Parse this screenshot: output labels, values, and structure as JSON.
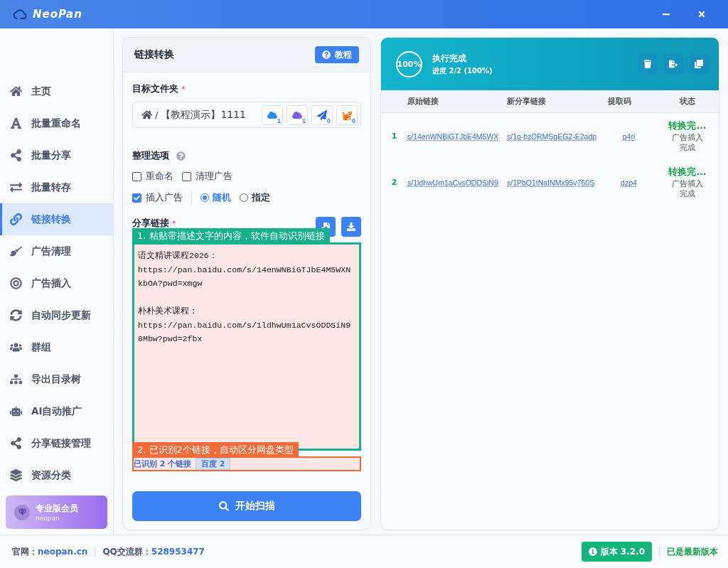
{
  "window": {
    "title": "NeoPan"
  },
  "sidebar": {
    "items": [
      {
        "label": "主页",
        "selected": false
      },
      {
        "label": "批量重命名",
        "selected": false
      },
      {
        "label": "批量分享",
        "selected": false
      },
      {
        "label": "批量转存",
        "selected": false
      },
      {
        "label": "链接转换",
        "selected": true
      },
      {
        "label": "广告清理",
        "selected": false
      },
      {
        "label": "广告插入",
        "selected": false
      },
      {
        "label": "自动同步更新",
        "selected": false
      },
      {
        "label": "群组",
        "selected": false
      },
      {
        "label": "导出目录树",
        "selected": false
      },
      {
        "label": "AI自动推广",
        "selected": false
      },
      {
        "label": "分享链接管理",
        "selected": false
      },
      {
        "label": "资源分类",
        "selected": false
      }
    ],
    "member": {
      "title": "专业版会员",
      "subtitle": "neopan"
    }
  },
  "convert_panel": {
    "title": "链接转换",
    "help_button": "教程",
    "target_folder": {
      "label": "目标文件夹",
      "required_mark": "*",
      "separator": "/",
      "path": "【教程演示】1111",
      "services": [
        {
          "count": "1"
        },
        {
          "count": "1"
        },
        {
          "count": "0"
        },
        {
          "count": "0"
        }
      ]
    },
    "options": {
      "label": "整理选项",
      "checkboxes": [
        {
          "label": "重命名",
          "checked": false
        },
        {
          "label": "清理广告",
          "checked": false
        },
        {
          "label": "插入广告",
          "checked": true
        }
      ],
      "radios": [
        {
          "label": "随机",
          "selected": true
        },
        {
          "label": "指定",
          "selected": false
        }
      ]
    },
    "share_links": {
      "label": "分享链接",
      "required_mark": "*",
      "value": "语文精讲课程2026：\nhttps://pan.baidu.com/s/14enWNBiGTJbE4M5WXNkbOA?pwd=xmgw\n\n朴朴美术课程：\nhttps://pan.baidu.com/s/1ldhwUm1aCvsODDSiN98Mbw?pwd=2fbx",
      "detected": "已识别 2 个链接",
      "tags": [
        "百度 2"
      ]
    },
    "start_button": "开始扫描",
    "annotations": [
      {
        "text": "1. 粘贴带描述文字的内容，软件自动识别链接",
        "color": "#16b08b"
      },
      {
        "text": "2. 已识别2个链接，自动区分网盘类型",
        "color": "#f26b38"
      }
    ]
  },
  "result_panel": {
    "progress_ring": "100%",
    "status": "执行完成",
    "progress": "进度 2/2 (100%)",
    "columns": [
      "原始链接",
      "新分享链接",
      "提取码",
      "状态"
    ],
    "rows": [
      {
        "index": "1",
        "original": "s/14enWNBiGTJbE4M5WX",
        "new_link": "s/1q-bzDRMSqEG2-E2adp",
        "code": "p4ri",
        "status": "转换完...",
        "note": "广告插入完成"
      },
      {
        "index": "2",
        "original": "s/1ldhwUm1aCvsODDSiN9",
        "new_link": "s/1PbQ1tNaINMx95v760S",
        "code": "dzp4",
        "status": "转换完...",
        "note": "广告插入完成"
      }
    ]
  },
  "status_bar": {
    "site_label": "官网：",
    "site": "neopan.cn",
    "qq_label": "QQ交流群：",
    "qq": "528953477",
    "version": "版本 3.2.0",
    "update_status": "已是最新版本"
  }
}
